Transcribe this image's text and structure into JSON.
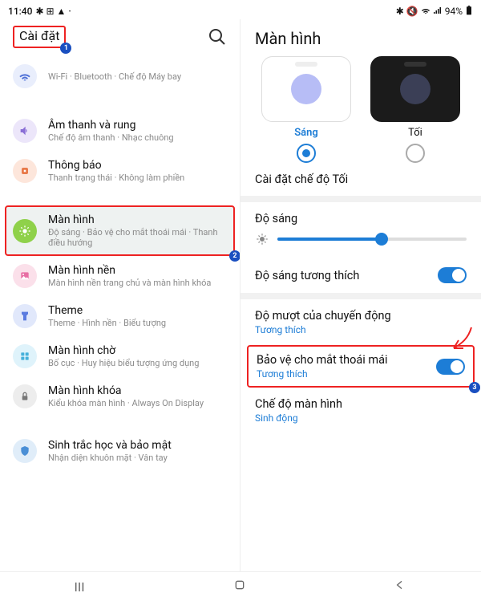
{
  "status": {
    "time": "11:40",
    "battery": "94%"
  },
  "left": {
    "title": "Cài đặt",
    "items": [
      {
        "key": "conn",
        "title": "",
        "sub": "Wi-Fi · Bluetooth · Chế độ Máy bay"
      },
      {
        "key": "sound",
        "title": "Âm thanh và rung",
        "sub": "Chế độ âm thanh · Nhạc chuông"
      },
      {
        "key": "notif",
        "title": "Thông báo",
        "sub": "Thanh trạng thái · Không làm phiền"
      },
      {
        "key": "display",
        "title": "Màn hình",
        "sub": "Độ sáng · Bảo vệ cho mắt thoái mái · Thanh điều hướng"
      },
      {
        "key": "wallpaper",
        "title": "Màn hình nền",
        "sub": "Màn hình nền trang chủ và màn hình khóa"
      },
      {
        "key": "theme",
        "title": "Theme",
        "sub": "Theme · Hình nền · Biểu tượng"
      },
      {
        "key": "home",
        "title": "Màn hình chờ",
        "sub": "Bố cục · Huy hiệu biểu tượng ứng dụng"
      },
      {
        "key": "lock",
        "title": "Màn hình khóa",
        "sub": "Kiểu khóa màn hình · Always On Display"
      },
      {
        "key": "bio",
        "title": "Sinh trắc học và bảo mật",
        "sub": "Nhận diện khuôn mặt · Vân tay"
      }
    ]
  },
  "right": {
    "title": "Màn hình",
    "light": "Sáng",
    "dark": "Tối",
    "dark_mode_settings": "Cài đặt chế độ Tối",
    "brightness": "Độ sáng",
    "brightness_pct": 55,
    "adaptive": "Độ sáng tương thích",
    "motion": "Độ mượt của chuyến động",
    "motion_sub": "Tương thích",
    "eye": "Bảo vệ cho mắt thoái mái",
    "eye_sub": "Tương thích",
    "screen_mode": "Chế độ màn hình",
    "screen_mode_sub": "Sinh động"
  },
  "annot": {
    "b1": "1",
    "b2": "2",
    "b3": "3"
  }
}
